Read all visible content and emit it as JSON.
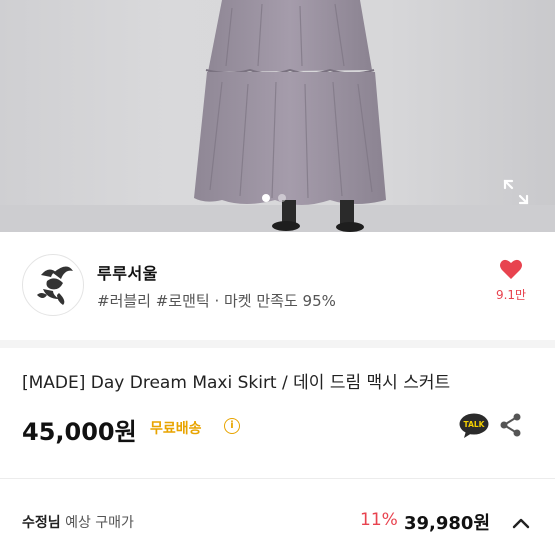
{
  "product_image": {
    "current_index": 1,
    "total_images": 2
  },
  "seller": {
    "name": "루루서울",
    "tags": "#러블리 #로맨틱 · 마켓 만족도 95%",
    "like_count": "9.1만"
  },
  "product": {
    "title": "[MADE] Day Dream Maxi Skirt / 데이 드림 맥시 스커트",
    "price": "45,000원",
    "shipping": "무료배송",
    "info_icon": "i",
    "talk_label": "TALK"
  },
  "coupon": {
    "user": "수정님",
    "label": " 예상 구매가",
    "discount": "11%",
    "price": "39,980원"
  },
  "colors": {
    "accent_red": "#e8434f",
    "shipping_yellow": "#e8a400"
  }
}
